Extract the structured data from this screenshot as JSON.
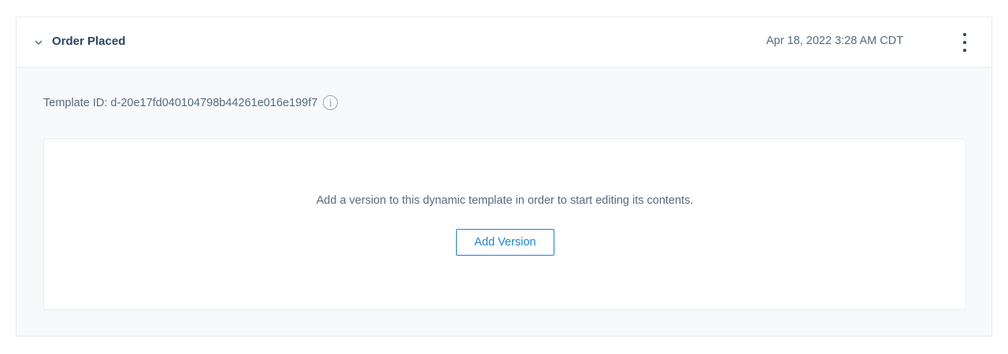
{
  "template": {
    "title": "Order Placed",
    "timestamp": "Apr 18, 2022 3:28 AM CDT",
    "id_label": "Template ID: d-20e17fd040104798b44261e016e199f7",
    "info_icon": "info-icon",
    "menu_icon": "kebab-menu-icon",
    "collapse_icon": "chevron-down-icon"
  },
  "empty_state": {
    "message": "Add a version to this dynamic template in order to start editing its contents.",
    "button_label": "Add Version"
  },
  "colors": {
    "accent": "#1a82e2",
    "text_primary": "#294661",
    "text_secondary": "#546b81",
    "border": "#e9ecef",
    "card_background": "#f8f9fa"
  }
}
